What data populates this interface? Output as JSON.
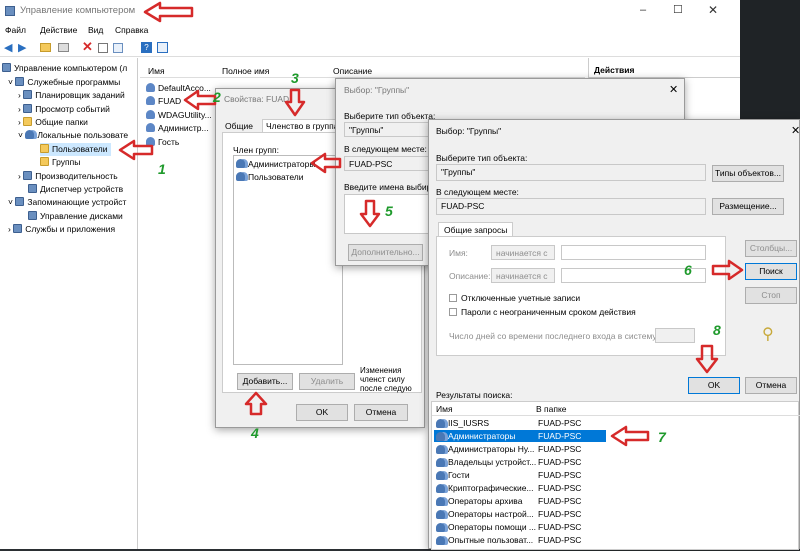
{
  "app": {
    "title": "Управление компьютером",
    "menu": [
      "Файл",
      "Действие",
      "Вид",
      "Справка"
    ]
  },
  "tree": [
    {
      "label": "Управление компьютером (л",
      "level": 0
    },
    {
      "label": "Служебные программы",
      "level": 1
    },
    {
      "label": "Планировщик заданий",
      "level": 2
    },
    {
      "label": "Просмотр событий",
      "level": 2
    },
    {
      "label": "Общие папки",
      "level": 2
    },
    {
      "label": "Локальные пользовате",
      "level": 2
    },
    {
      "label": "Пользователи",
      "level": 3
    },
    {
      "label": "Группы",
      "level": 3
    },
    {
      "label": "Производительность",
      "level": 2
    },
    {
      "label": "Диспетчер устройств",
      "level": 2
    },
    {
      "label": "Запоминающие устройст",
      "level": 1
    },
    {
      "label": "Управление дисками",
      "level": 2
    },
    {
      "label": "Службы и приложения",
      "level": 1
    }
  ],
  "list": {
    "headers": [
      "Имя",
      "Полное имя",
      "Описание"
    ],
    "items": [
      "DefaultAcco...",
      "FUAD",
      "WDAGUtility...",
      "Администр...",
      "Гость"
    ]
  },
  "actions_title": "Действия",
  "props": {
    "title": "Свойства: FUAD",
    "tabs": [
      "Общие",
      "Членство в группах"
    ],
    "member_of_label": "Член групп:",
    "groups": [
      "Администраторы",
      "Пользователи"
    ],
    "add": "Добавить...",
    "remove": "Удалить",
    "note": "Изменения членст силу после следую пользователя в сис",
    "ok": "OK",
    "cancel": "Отмена"
  },
  "sel1": {
    "title": "Выбор: \"Группы\"",
    "type_label": "Выберите тип объекта:",
    "type_value": "\"Группы\"",
    "loc_label": "В следующем месте:",
    "loc_value": "FUAD-PSC",
    "names_label": "Введите имена выбир",
    "advanced": "Дополнительно..."
  },
  "sel2": {
    "title": "Выбор: \"Группы\"",
    "type_label": "Выберите тип объекта:",
    "type_value": "\"Группы\"",
    "types_btn": "Типы объектов...",
    "loc_label": "В следующем месте:",
    "loc_value": "FUAD-PSC",
    "loc_btn": "Размещение...",
    "tab": "Общие запросы",
    "name_label": "Имя:",
    "desc_label": "Описание:",
    "starts": "начинается с",
    "columns_btn": "Столбцы...",
    "search_btn": "Поиск",
    "stop_btn": "Стоп",
    "disabled_cb": "Отключенные учетные записи",
    "pwd_cb": "Пароли с неограниченным сроком действия",
    "days_label": "Число дней со времени последнего входа в систему:",
    "ok": "OK",
    "cancel": "Отмена",
    "results_label": "Результаты поиска:",
    "res_headers": [
      "Имя",
      "В папке"
    ],
    "results": [
      {
        "name": "IIS_IUSRS",
        "folder": "FUAD-PSC"
      },
      {
        "name": "Администраторы",
        "folder": "FUAD-PSC"
      },
      {
        "name": "Администраторы Ну...",
        "folder": "FUAD-PSC"
      },
      {
        "name": "Владельцы устройст...",
        "folder": "FUAD-PSC"
      },
      {
        "name": "Гости",
        "folder": "FUAD-PSC"
      },
      {
        "name": "Криптографические...",
        "folder": "FUAD-PSC"
      },
      {
        "name": "Операторы архива",
        "folder": "FUAD-PSC"
      },
      {
        "name": "Операторы настрой...",
        "folder": "FUAD-PSC"
      },
      {
        "name": "Операторы помощи ...",
        "folder": "FUAD-PSC"
      },
      {
        "name": "Опытные пользоват...",
        "folder": "FUAD-PSC"
      }
    ]
  },
  "annotations": [
    "1",
    "2",
    "3",
    "4",
    "5",
    "6",
    "7",
    "8"
  ],
  "colors": {
    "arrow": "#d62a2a",
    "number": "#1f9a2c",
    "selection": "#0078d7"
  }
}
